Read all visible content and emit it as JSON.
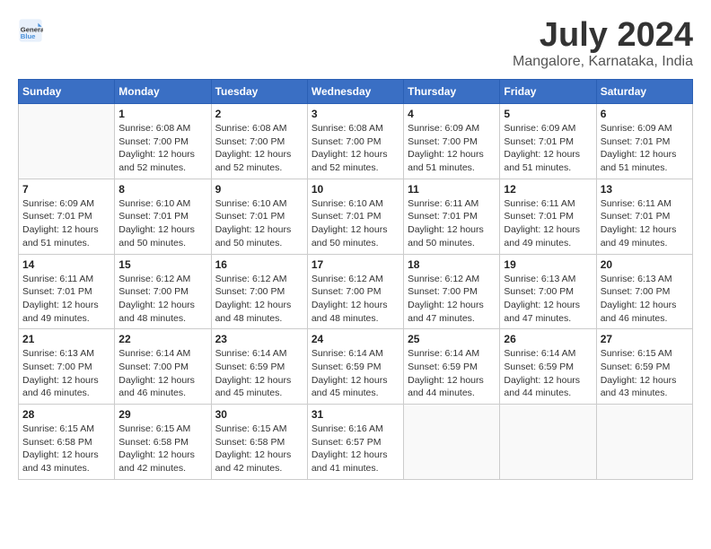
{
  "header": {
    "logo_line1": "General",
    "logo_line2": "Blue",
    "month": "July 2024",
    "location": "Mangalore, Karnataka, India"
  },
  "weekdays": [
    "Sunday",
    "Monday",
    "Tuesday",
    "Wednesday",
    "Thursday",
    "Friday",
    "Saturday"
  ],
  "weeks": [
    [
      {
        "day": "",
        "info": ""
      },
      {
        "day": "1",
        "info": "Sunrise: 6:08 AM\nSunset: 7:00 PM\nDaylight: 12 hours\nand 52 minutes."
      },
      {
        "day": "2",
        "info": "Sunrise: 6:08 AM\nSunset: 7:00 PM\nDaylight: 12 hours\nand 52 minutes."
      },
      {
        "day": "3",
        "info": "Sunrise: 6:08 AM\nSunset: 7:00 PM\nDaylight: 12 hours\nand 52 minutes."
      },
      {
        "day": "4",
        "info": "Sunrise: 6:09 AM\nSunset: 7:00 PM\nDaylight: 12 hours\nand 51 minutes."
      },
      {
        "day": "5",
        "info": "Sunrise: 6:09 AM\nSunset: 7:01 PM\nDaylight: 12 hours\nand 51 minutes."
      },
      {
        "day": "6",
        "info": "Sunrise: 6:09 AM\nSunset: 7:01 PM\nDaylight: 12 hours\nand 51 minutes."
      }
    ],
    [
      {
        "day": "7",
        "info": "Sunrise: 6:09 AM\nSunset: 7:01 PM\nDaylight: 12 hours\nand 51 minutes."
      },
      {
        "day": "8",
        "info": "Sunrise: 6:10 AM\nSunset: 7:01 PM\nDaylight: 12 hours\nand 50 minutes."
      },
      {
        "day": "9",
        "info": "Sunrise: 6:10 AM\nSunset: 7:01 PM\nDaylight: 12 hours\nand 50 minutes."
      },
      {
        "day": "10",
        "info": "Sunrise: 6:10 AM\nSunset: 7:01 PM\nDaylight: 12 hours\nand 50 minutes."
      },
      {
        "day": "11",
        "info": "Sunrise: 6:11 AM\nSunset: 7:01 PM\nDaylight: 12 hours\nand 50 minutes."
      },
      {
        "day": "12",
        "info": "Sunrise: 6:11 AM\nSunset: 7:01 PM\nDaylight: 12 hours\nand 49 minutes."
      },
      {
        "day": "13",
        "info": "Sunrise: 6:11 AM\nSunset: 7:01 PM\nDaylight: 12 hours\nand 49 minutes."
      }
    ],
    [
      {
        "day": "14",
        "info": "Sunrise: 6:11 AM\nSunset: 7:01 PM\nDaylight: 12 hours\nand 49 minutes."
      },
      {
        "day": "15",
        "info": "Sunrise: 6:12 AM\nSunset: 7:00 PM\nDaylight: 12 hours\nand 48 minutes."
      },
      {
        "day": "16",
        "info": "Sunrise: 6:12 AM\nSunset: 7:00 PM\nDaylight: 12 hours\nand 48 minutes."
      },
      {
        "day": "17",
        "info": "Sunrise: 6:12 AM\nSunset: 7:00 PM\nDaylight: 12 hours\nand 48 minutes."
      },
      {
        "day": "18",
        "info": "Sunrise: 6:12 AM\nSunset: 7:00 PM\nDaylight: 12 hours\nand 47 minutes."
      },
      {
        "day": "19",
        "info": "Sunrise: 6:13 AM\nSunset: 7:00 PM\nDaylight: 12 hours\nand 47 minutes."
      },
      {
        "day": "20",
        "info": "Sunrise: 6:13 AM\nSunset: 7:00 PM\nDaylight: 12 hours\nand 46 minutes."
      }
    ],
    [
      {
        "day": "21",
        "info": "Sunrise: 6:13 AM\nSunset: 7:00 PM\nDaylight: 12 hours\nand 46 minutes."
      },
      {
        "day": "22",
        "info": "Sunrise: 6:14 AM\nSunset: 7:00 PM\nDaylight: 12 hours\nand 46 minutes."
      },
      {
        "day": "23",
        "info": "Sunrise: 6:14 AM\nSunset: 6:59 PM\nDaylight: 12 hours\nand 45 minutes."
      },
      {
        "day": "24",
        "info": "Sunrise: 6:14 AM\nSunset: 6:59 PM\nDaylight: 12 hours\nand 45 minutes."
      },
      {
        "day": "25",
        "info": "Sunrise: 6:14 AM\nSunset: 6:59 PM\nDaylight: 12 hours\nand 44 minutes."
      },
      {
        "day": "26",
        "info": "Sunrise: 6:14 AM\nSunset: 6:59 PM\nDaylight: 12 hours\nand 44 minutes."
      },
      {
        "day": "27",
        "info": "Sunrise: 6:15 AM\nSunset: 6:59 PM\nDaylight: 12 hours\nand 43 minutes."
      }
    ],
    [
      {
        "day": "28",
        "info": "Sunrise: 6:15 AM\nSunset: 6:58 PM\nDaylight: 12 hours\nand 43 minutes."
      },
      {
        "day": "29",
        "info": "Sunrise: 6:15 AM\nSunset: 6:58 PM\nDaylight: 12 hours\nand 42 minutes."
      },
      {
        "day": "30",
        "info": "Sunrise: 6:15 AM\nSunset: 6:58 PM\nDaylight: 12 hours\nand 42 minutes."
      },
      {
        "day": "31",
        "info": "Sunrise: 6:16 AM\nSunset: 6:57 PM\nDaylight: 12 hours\nand 41 minutes."
      },
      {
        "day": "",
        "info": ""
      },
      {
        "day": "",
        "info": ""
      },
      {
        "day": "",
        "info": ""
      }
    ]
  ]
}
